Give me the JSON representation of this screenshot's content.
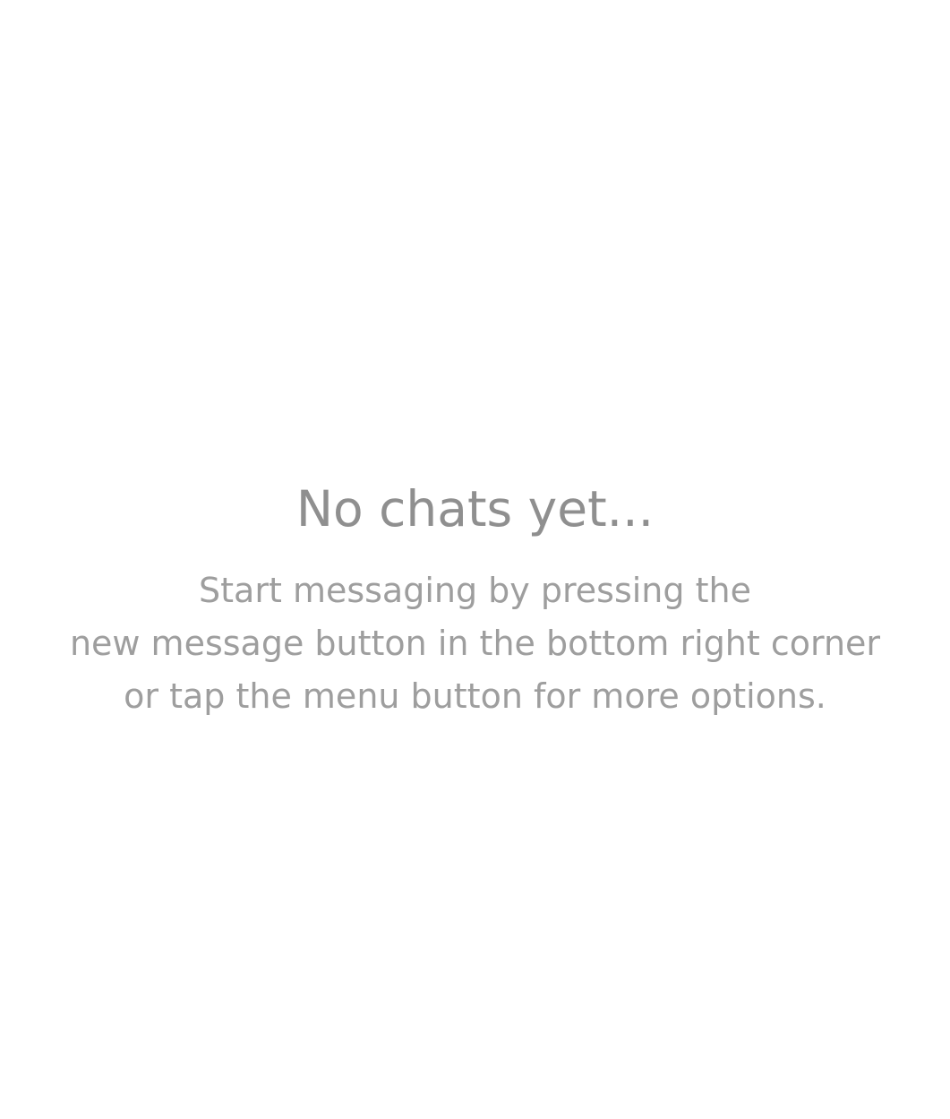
{
  "colors": {
    "background": "#ffffff",
    "title_text": "#8f8f8f",
    "body_text": "#9e9e9e"
  },
  "empty_state": {
    "title": "No chats yet...",
    "lines": [
      "Start messaging by pressing the",
      "new message button in the bottom right corner",
      "or tap the menu button for more options."
    ]
  }
}
